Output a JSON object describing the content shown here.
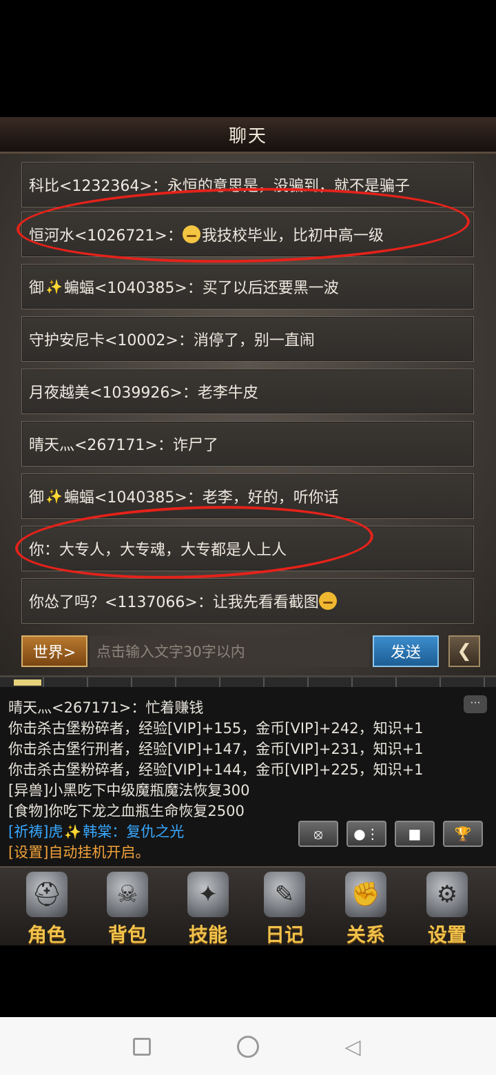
{
  "header": {
    "title": "聊天"
  },
  "chat_messages": [
    {
      "name": "科比<1232364>",
      "sep": "：",
      "text": "永恒的意思是，没骗到，就不是骗子"
    },
    {
      "name": "恒河水<1026721>",
      "sep": "：",
      "emoji": "face-with-rolling-eyes",
      "text": "我技校毕业，比初中高一级"
    },
    {
      "name_a": "御",
      "name_b": "蝙蝠<1040385>",
      "sep": "：",
      "text": "买了以后还要黑一波"
    },
    {
      "name": "守护安尼卡<10002>",
      "sep": "：",
      "text": "消停了，别一直闹"
    },
    {
      "name": "月夜越美<1039926>",
      "sep": "：",
      "text": "老李牛皮"
    },
    {
      "name": "晴天灬<267171>",
      "sep": "：",
      "text": "诈尸了"
    },
    {
      "name_a": "御",
      "name_b": "蝙蝠<1040385>",
      "sep": "：",
      "text": "老李，好的，听你话"
    },
    {
      "name": "你",
      "sep": "：",
      "text": "大专人，大专魂，大专都是人上人"
    },
    {
      "name": "你怂了吗？<1137066>",
      "sep": "：",
      "text": "让我先看看截图",
      "emoji_end": "thinking-face"
    }
  ],
  "input_bar": {
    "channel_label": "世界>",
    "placeholder": "点击输入文字30字以内",
    "send_label": "发送",
    "back_icon": "chevron-left-icon"
  },
  "log": {
    "lines": [
      {
        "text": "晴天灬<267171>：忙着赚钱",
        "color": "#e8e4dc"
      },
      {
        "text": "你击杀古堡粉碎者，经验[VIP]+155，金币[VIP]+242，知识+1",
        "color": "#e8e4dc"
      },
      {
        "text": "你击杀古堡行刑者，经验[VIP]+147，金币[VIP]+231，知识+1",
        "color": "#e8e4dc"
      },
      {
        "text": "你击杀古堡粉碎者，经验[VIP]+144，金币[VIP]+225，知识+1",
        "color": "#e8e4dc"
      },
      {
        "text": "[异兽]小黑吃下中级魔瓶魔法恢复300",
        "color": "#e8e4dc"
      },
      {
        "text": "[食物]你吃下龙之血瓶生命恢复2500",
        "color": "#e8e4dc"
      },
      {
        "text_a": "[祈祷]虎",
        "text_b": "韩棠：复仇之光",
        "color": "#38a8ff"
      },
      {
        "text": "[设置]自动挂机开启。",
        "color": "#f2a23a"
      }
    ],
    "bubble": "···"
  },
  "nav": [
    {
      "label": "角色",
      "icon": "helmet-icon",
      "glyph": "⛑"
    },
    {
      "label": "背包",
      "icon": "backpack-icon",
      "glyph": "☠"
    },
    {
      "label": "技能",
      "icon": "skill-book-icon",
      "glyph": "✦"
    },
    {
      "label": "日记",
      "icon": "scroll-icon",
      "glyph": "✎"
    },
    {
      "label": "关系",
      "icon": "gauntlet-icon",
      "glyph": "✊"
    },
    {
      "label": "设置",
      "icon": "gear-icon",
      "glyph": "⚙"
    }
  ],
  "annotation_color": "#e5221a"
}
